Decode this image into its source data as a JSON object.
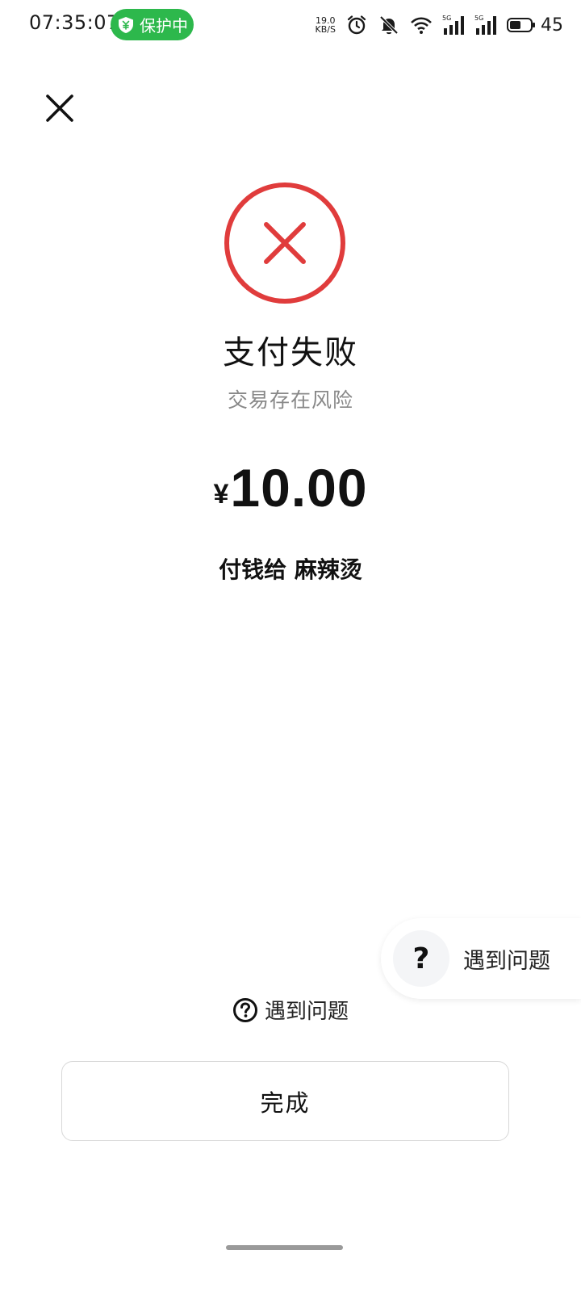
{
  "status_bar": {
    "time": "07:35:07",
    "protect_label": "保护中",
    "net_speed_value": "19.0",
    "net_speed_unit": "KB/S",
    "signal1_label": "5G",
    "signal2_label": "5G",
    "battery": "45",
    "pill_color": "#2db84c"
  },
  "result": {
    "title": "支付失败",
    "subtitle": "交易存在风险",
    "currency": "¥",
    "amount": "10.00",
    "payee": "付钱给 麻辣烫",
    "status_color": "#e03c3c"
  },
  "float_help": {
    "icon": "?",
    "label": "遇到问题"
  },
  "help_link": {
    "label": "遇到问题"
  },
  "done_button": {
    "label": "完成"
  }
}
